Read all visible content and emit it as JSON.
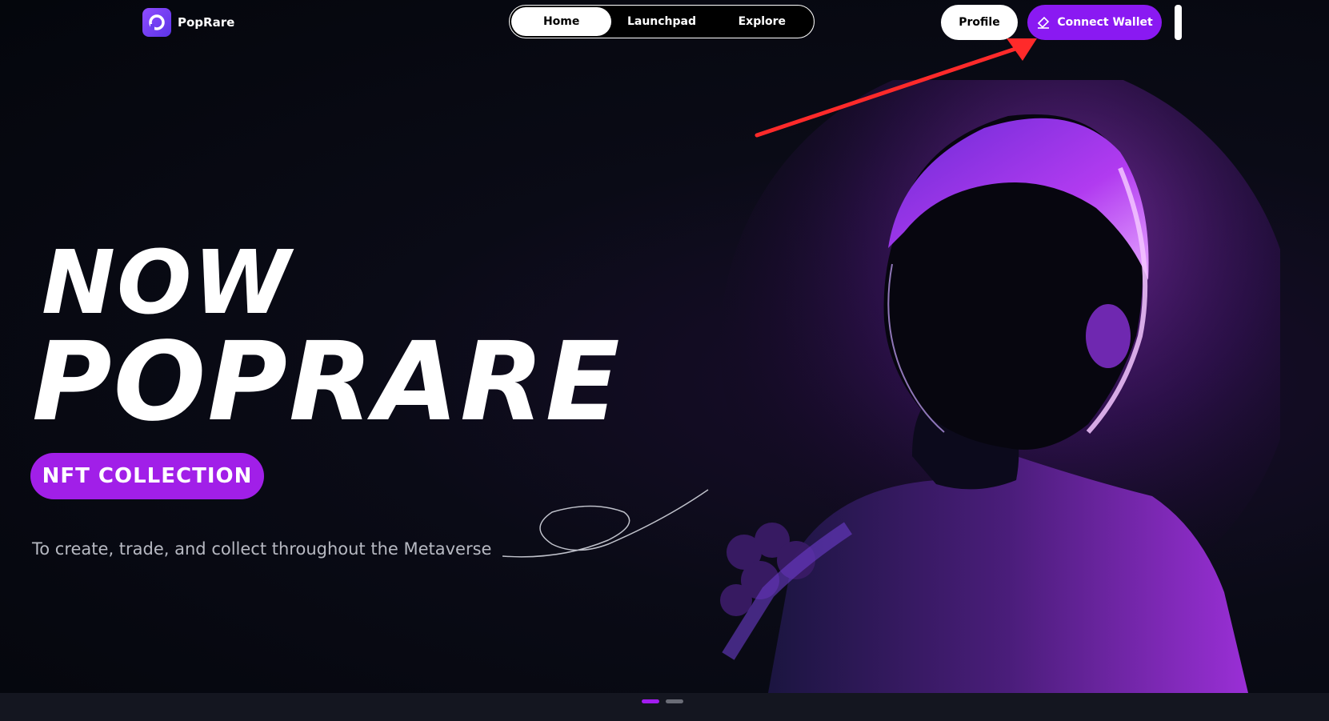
{
  "header": {
    "logo_text": "PopRare",
    "nav_tabs": [
      {
        "label": "Home",
        "active": true
      },
      {
        "label": "Launchpad",
        "active": false
      },
      {
        "label": "Explore",
        "active": false
      }
    ],
    "profile_label": "Profile",
    "connect_wallet_label": "Connect Wallet"
  },
  "hero": {
    "headline_line1": "NOW",
    "headline_line2": "POPRARE",
    "badge_label": "NFT COLLECTION",
    "tagline": "To create, trade, and collect throughout the Metaverse"
  },
  "carousel": {
    "slide_count": 2,
    "active_index": 0
  },
  "colors": {
    "accent_purple": "#8a19f2",
    "badge_purple": "#a11fe8",
    "background": "#05080f",
    "annotation_red": "#ff2a2a"
  },
  "icons": {
    "logo": "poprare-logo-icon",
    "wallet": "diamond-icon"
  }
}
